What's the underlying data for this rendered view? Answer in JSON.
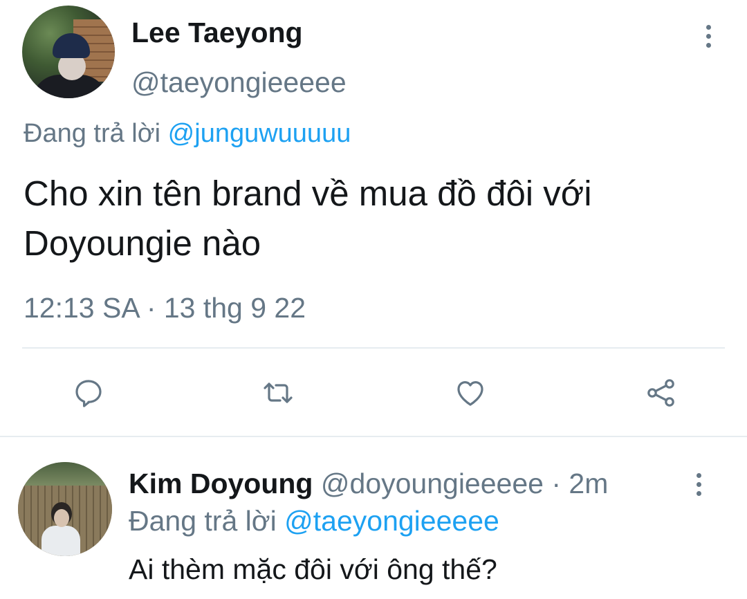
{
  "main_tweet": {
    "author_name": "Lee Taeyong",
    "author_handle": "@taeyongieeeee",
    "reply_prefix": "Đang trả lời",
    "reply_mention": "@junguwuuuuu",
    "text": "Cho xin tên brand về mua đồ đôi với Doyoungie nào",
    "timestamp": "12:13 SA · 13 thg 9 22",
    "actions": [
      "reply-icon",
      "retweet-icon",
      "like-icon",
      "share-icon"
    ]
  },
  "reply_tweet": {
    "author_name": "Kim Doyoung",
    "author_handle": "@doyoungieeeee",
    "separator": "·",
    "time_ago": "2m",
    "reply_prefix": "Đang trả lời",
    "reply_mention": "@taeyongieeeee",
    "text": "Ai thèm mặc đôi với ông thế?"
  },
  "colors": {
    "text": "#14171a",
    "secondary": "#657786",
    "accent": "#1da1f2",
    "divider": "#e6ecf0"
  }
}
